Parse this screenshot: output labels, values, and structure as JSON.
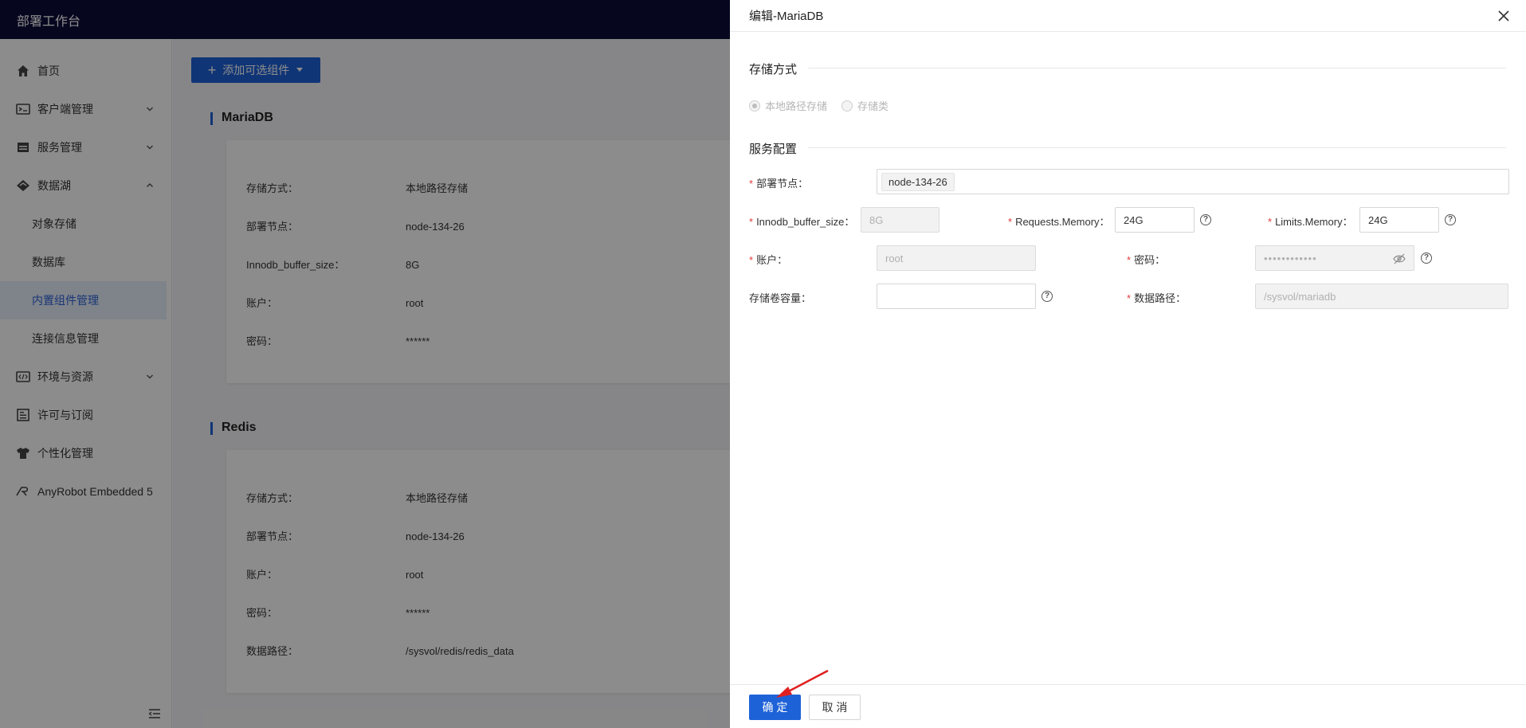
{
  "app": {
    "title": "部署工作台"
  },
  "sidebar": {
    "items": [
      {
        "label": "首页",
        "icon": "home-icon"
      },
      {
        "label": "客户端管理",
        "icon": "client-icon",
        "expandable": true
      },
      {
        "label": "服务管理",
        "icon": "service-icon",
        "expandable": true
      },
      {
        "label": "数据湖",
        "icon": "datalake-icon",
        "expandable": true,
        "expanded": true
      },
      {
        "label": "对象存储",
        "sub": true
      },
      {
        "label": "数据库",
        "sub": true
      },
      {
        "label": "内置组件管理",
        "sub": true,
        "active": true
      },
      {
        "label": "连接信息管理",
        "sub": true
      },
      {
        "label": "环境与资源",
        "icon": "code-icon",
        "expandable": true
      },
      {
        "label": "许可与订阅",
        "icon": "license-icon"
      },
      {
        "label": "个性化管理",
        "icon": "shirt-icon"
      },
      {
        "label": "AnyRobot Embedded 5",
        "icon": "anyrobot-icon"
      }
    ]
  },
  "main": {
    "add_button": "添加可选组件",
    "mariadb": {
      "title": "MariaDB",
      "rows": [
        {
          "k": "存储方式：",
          "v": "本地路径存储"
        },
        {
          "k": "部署节点：",
          "v": "node-134-26"
        },
        {
          "k": "Innodb_buffer_size：",
          "v": "8G"
        },
        {
          "k": "账户：",
          "v": "root"
        },
        {
          "k": "密码：",
          "v": "******"
        }
      ]
    },
    "redis": {
      "title": "Redis",
      "rows": [
        {
          "k": "存储方式：",
          "v": "本地路径存储"
        },
        {
          "k": "部署节点：",
          "v": "node-134-26"
        },
        {
          "k": "账户：",
          "v": "root"
        },
        {
          "k": "密码：",
          "v": "******"
        },
        {
          "k": "数据路径：",
          "v": "/sysvol/redis/redis_data"
        }
      ]
    }
  },
  "drawer": {
    "title": "编辑-MariaDB",
    "storage_group": "存储方式",
    "storage_options": [
      "本地路径存储",
      "存储类"
    ],
    "service_group": "服务配置",
    "fields": {
      "node_label": "部署节点：",
      "node_value": "node-134-26",
      "innodb_label": "Innodb_buffer_size：",
      "innodb_value": "8G",
      "req_mem_label": "Requests.Memory：",
      "req_mem_value": "24G",
      "lim_mem_label": "Limits.Memory：",
      "lim_mem_value": "24G",
      "account_label": "账户：",
      "account_value": "root",
      "password_label": "密码：",
      "password_value": "••••••••••••",
      "volume_label": "存储卷容量：",
      "volume_value": "",
      "datapath_label": "数据路径：",
      "datapath_value": "/sysvol/mariadb"
    },
    "ok": "确 定",
    "cancel": "取 消"
  },
  "colors": {
    "primary": "#1e62d8",
    "topbar": "#0b0c3a",
    "annotation_arrow": "#e02020"
  }
}
